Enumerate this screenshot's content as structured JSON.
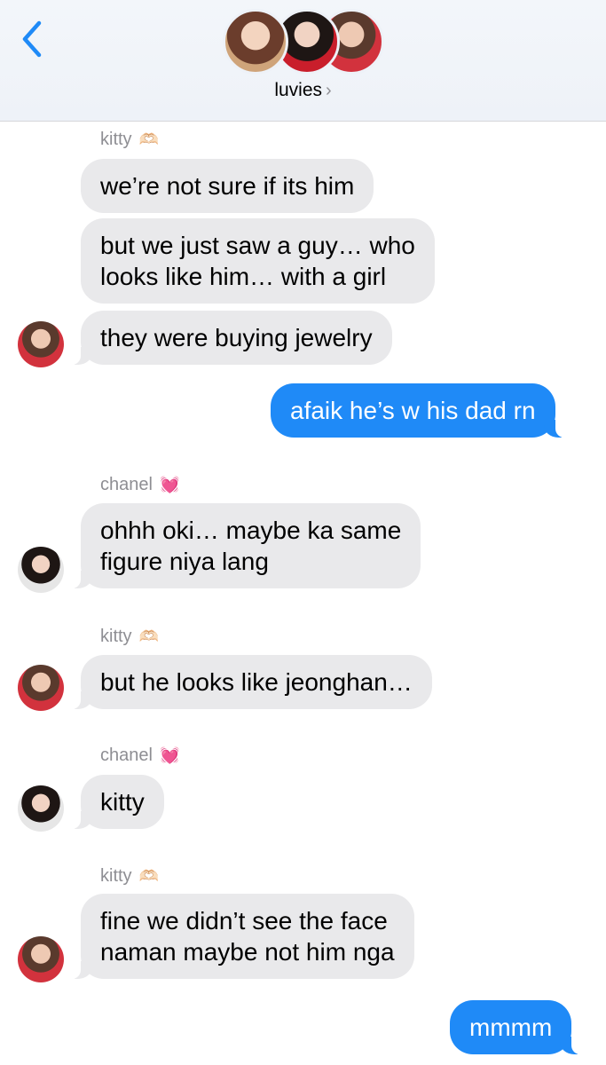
{
  "header": {
    "group_name": "luvies",
    "chevron": "›",
    "icons": {
      "back": "chevron-left-icon",
      "disclosure": "chevron-right-icon"
    },
    "accent_color": "#1f8af7"
  },
  "senders": {
    "kitty": {
      "name": "kitty",
      "emoji": "🫶🏻"
    },
    "chanel": {
      "name": "chanel",
      "emoji": "💓"
    }
  },
  "messages": [
    {
      "from": "kitty",
      "text": "we’re not sure if its him"
    },
    {
      "from": "kitty",
      "lines": [
        "but we just saw a guy… who",
        "looks like him… with a girl"
      ]
    },
    {
      "from": "kitty",
      "text": "they were buying jewelry"
    },
    {
      "from": "me",
      "text": "afaik he’s w his dad rn"
    },
    {
      "from": "chanel",
      "lines": [
        "ohhh oki… maybe ka same",
        "figure niya lang"
      ]
    },
    {
      "from": "kitty",
      "text": "but he looks like jeonghan…"
    },
    {
      "from": "chanel",
      "text": "kitty"
    },
    {
      "from": "kitty",
      "lines": [
        "fine we didn’t see the face",
        "naman maybe not him nga"
      ]
    },
    {
      "from": "me",
      "text": "mmmm"
    }
  ],
  "colors": {
    "incoming_bubble": "#e9e9eb",
    "outgoing_bubble": "#1f8af7",
    "sender_label": "#8e8e93"
  }
}
